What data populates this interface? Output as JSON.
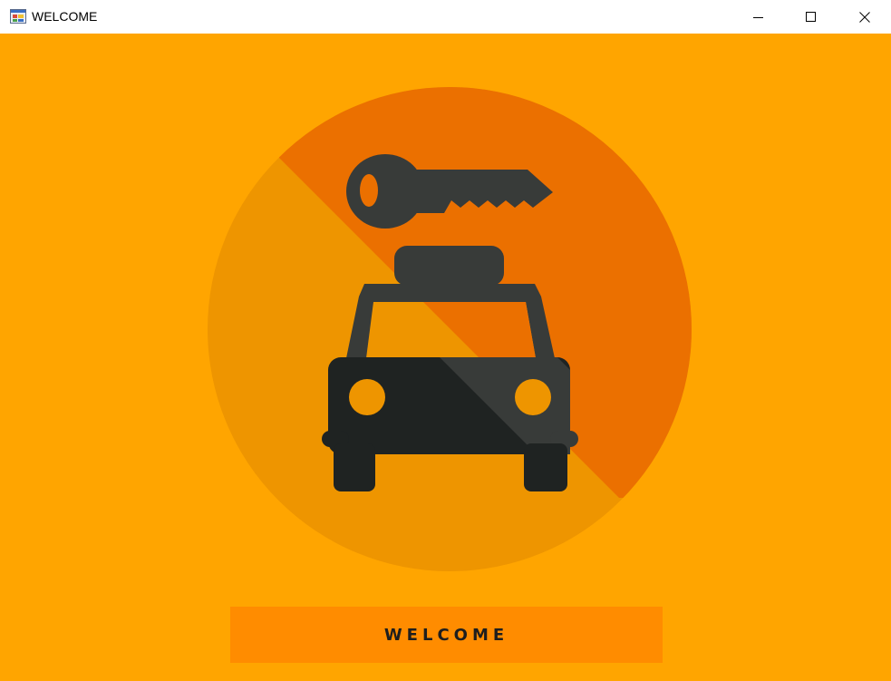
{
  "window": {
    "title": "WELCOME",
    "app_icon": "windows-form-icon",
    "controls": {
      "minimize_icon": "minimize-icon",
      "maximize_icon": "maximize-icon",
      "close_icon": "close-icon"
    }
  },
  "content": {
    "background_color": "#FFA500",
    "illustration": "car-key-taxi-icon",
    "welcome_button_label": "WELCOME",
    "welcome_button_color": "#FF8C00"
  }
}
